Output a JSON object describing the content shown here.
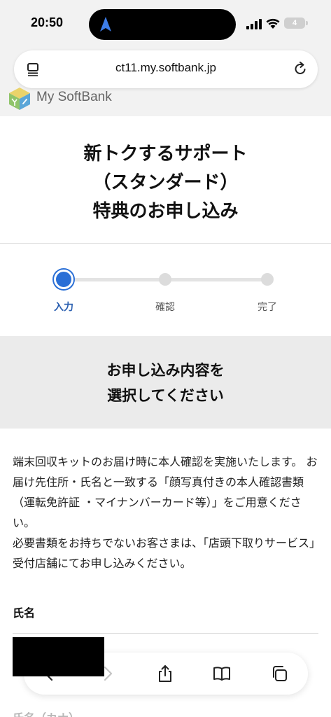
{
  "status": {
    "time": "20:50",
    "battery": "4"
  },
  "browser": {
    "url": "ct11.my.softbank.jp"
  },
  "brand": {
    "name": "My SoftBank"
  },
  "page": {
    "title_lines": [
      "新トクするサポート",
      "（スタンダード）",
      "特典のお申し込み"
    ]
  },
  "stepper": {
    "steps": [
      {
        "label": "入力",
        "active": true
      },
      {
        "label": "確認",
        "active": false
      },
      {
        "label": "完了",
        "active": false
      }
    ]
  },
  "instruction": {
    "lines": [
      "お申し込み内容を",
      "選択してください"
    ]
  },
  "notice": {
    "paragraph1": "端末回収キットのお届け時に本人確認を実施いたします。 お届け先住所・氏名と一致する「顔写真付きの本人確認書類（運転免許証 ・マイナンバーカード等）」をご用意ください。",
    "paragraph2": "必要書類をお持ちでないお客さまは、「店頭下取りサービス」受付店舗にてお申し込みください。"
  },
  "form": {
    "name_label": "氏名",
    "next_label": "氏名（カナ）"
  },
  "colors": {
    "accent": "#2a6fd6",
    "band": "#ebebeb"
  }
}
